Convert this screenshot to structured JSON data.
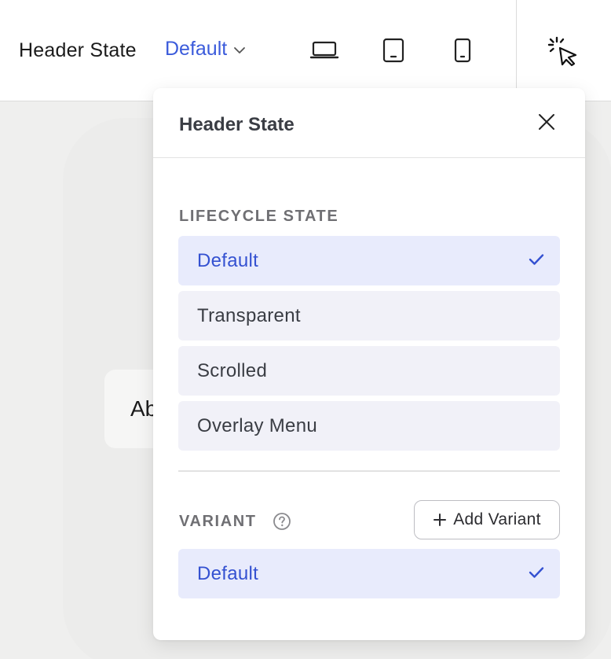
{
  "topbar": {
    "title": "Header State",
    "state_value": "Default",
    "devices": [
      "laptop-icon",
      "tablet-icon",
      "phone-icon"
    ],
    "tool_icon": "cursor-click-icon"
  },
  "canvas": {
    "chip_text": "Ab"
  },
  "panel": {
    "title": "Header State",
    "lifecycle_label": "LIFECYCLE STATE",
    "lifecycle_options": [
      {
        "label": "Default",
        "selected": true
      },
      {
        "label": "Transparent",
        "selected": false
      },
      {
        "label": "Scrolled",
        "selected": false
      },
      {
        "label": "Overlay Menu",
        "selected": false
      }
    ],
    "variant_label": "VARIANT",
    "add_variant_label": "Add Variant",
    "variant_options": [
      {
        "label": "Default",
        "selected": true
      }
    ]
  },
  "colors": {
    "accent": "#3451d1",
    "selected_bg": "#e8ebfc",
    "option_bg": "#f1f1f8"
  }
}
